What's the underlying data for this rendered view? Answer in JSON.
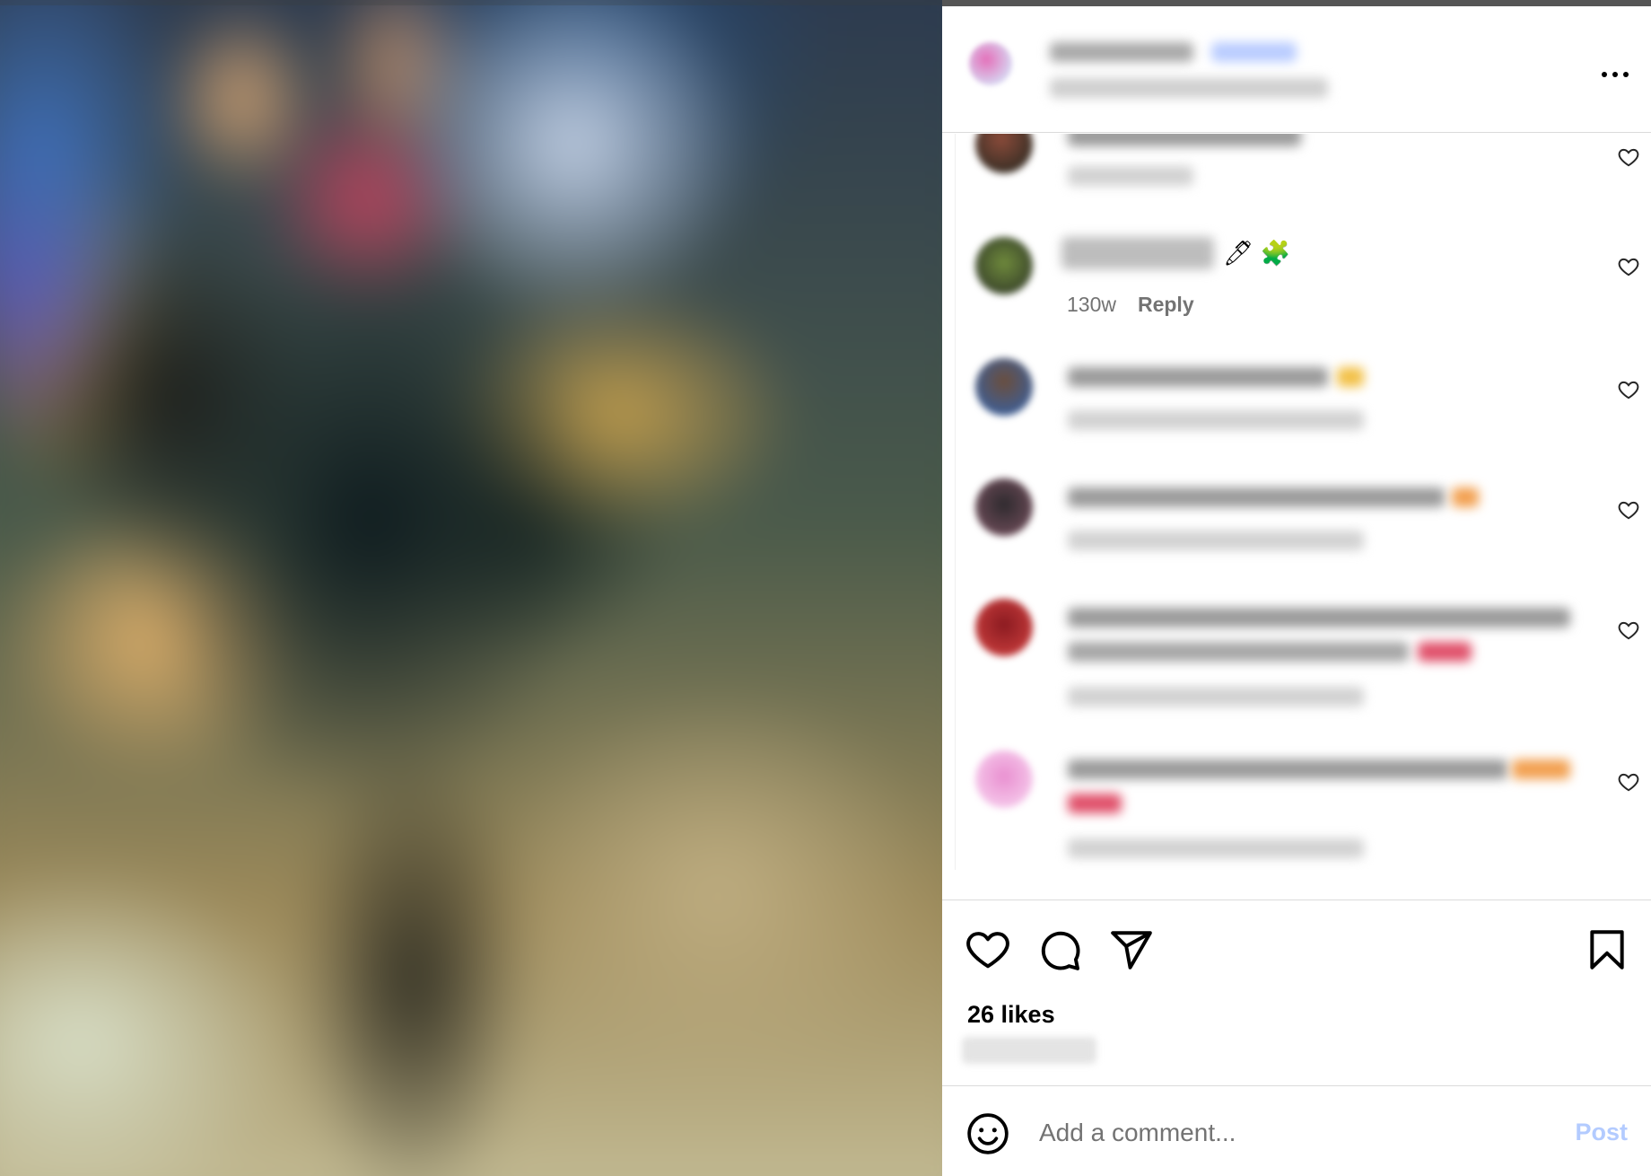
{
  "post": {
    "header": {
      "more_icon": "more-horizontal-icon"
    },
    "comments": [
      {
        "emoji": "",
        "time": "",
        "reply_label": "",
        "translation_label": ""
      },
      {
        "emoji": "🖊 🧩",
        "time": "130w",
        "reply_label": "Reply",
        "translation_label": ""
      },
      {
        "emoji": "",
        "time": "",
        "reply_label": "",
        "translation_label": ""
      },
      {
        "emoji": "",
        "time": "",
        "reply_label": "",
        "translation_label": ""
      },
      {
        "emoji": "",
        "time": "",
        "reply_label": "",
        "translation_label": ""
      },
      {
        "emoji": "",
        "time": "",
        "reply_label": "",
        "translation_label": ""
      }
    ],
    "actions": {
      "like_icon": "heart-icon",
      "comment_icon": "comment-icon",
      "share_icon": "send-icon",
      "save_icon": "bookmark-icon"
    },
    "likes_text": "26 likes",
    "composer": {
      "placeholder": "Add a comment...",
      "post_label": "Post",
      "post_color": "#b3cbff"
    }
  }
}
